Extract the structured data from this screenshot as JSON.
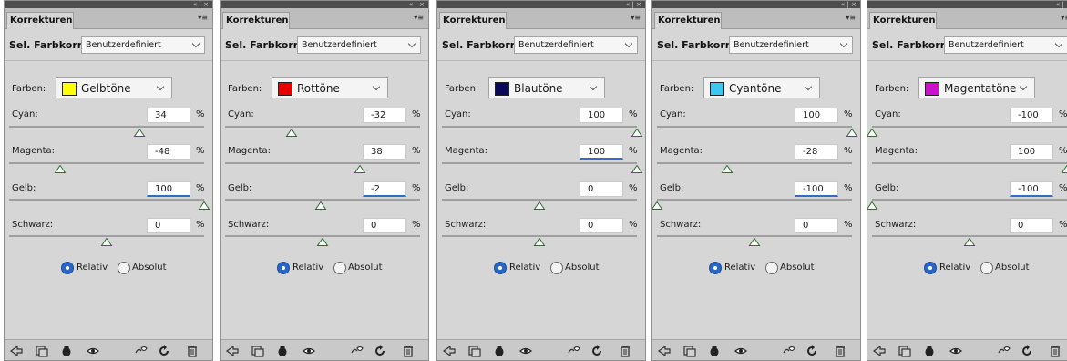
{
  "common": {
    "panel_tab": "Korrekturen",
    "adjustment_label": "Sel. Farbkorr.",
    "preset_value": "Benutzerdefiniert",
    "farben_label": "Farben:",
    "pct": "%",
    "relativ_label": "Relativ",
    "absolut_label": "Absolut",
    "method_selected": "Relativ",
    "titlebar_controls": "« | ×",
    "footer_icons": [
      "clip-to-layer-icon",
      "view-previous-state-icon",
      "reset-icon",
      "toggle-visibility-icon",
      "delete-icon"
    ]
  },
  "panels": [
    {
      "color_name": "Gelbtöne",
      "swatch": "#ffff00",
      "channels": [
        {
          "label": "Cyan:",
          "value": "34",
          "focused": false
        },
        {
          "label": "Magenta:",
          "value": "-48",
          "focused": false
        },
        {
          "label": "Gelb:",
          "value": "100",
          "focused": true
        },
        {
          "label": "Schwarz:",
          "value": "0",
          "focused": false
        }
      ]
    },
    {
      "color_name": "Rottöne",
      "swatch": "#e60000",
      "channels": [
        {
          "label": "Cyan:",
          "value": "-32",
          "focused": false
        },
        {
          "label": "Magenta:",
          "value": "38",
          "focused": false
        },
        {
          "label": "Gelb:",
          "value": "-2",
          "focused": true
        },
        {
          "label": "Schwarz:",
          "value": "0",
          "focused": false
        }
      ]
    },
    {
      "color_name": "Blautöne",
      "swatch": "#0a0a5a",
      "channels": [
        {
          "label": "Cyan:",
          "value": "100",
          "focused": false
        },
        {
          "label": "Magenta:",
          "value": "100",
          "focused": true
        },
        {
          "label": "Gelb:",
          "value": "0",
          "focused": false
        },
        {
          "label": "Schwarz:",
          "value": "0",
          "focused": false
        }
      ]
    },
    {
      "color_name": "Cyantöne",
      "swatch": "#3fc6f0",
      "channels": [
        {
          "label": "Cyan:",
          "value": "100",
          "focused": false
        },
        {
          "label": "Magenta:",
          "value": "-28",
          "focused": false
        },
        {
          "label": "Gelb:",
          "value": "-100",
          "focused": true
        },
        {
          "label": "Schwarz:",
          "value": "0",
          "focused": false
        }
      ]
    },
    {
      "color_name": "Magentatöne",
      "swatch": "#cc11cc",
      "channels": [
        {
          "label": "Cyan:",
          "value": "-100",
          "focused": false
        },
        {
          "label": "Magenta:",
          "value": "100",
          "focused": false
        },
        {
          "label": "Gelb:",
          "value": "-100",
          "focused": true
        },
        {
          "label": "Schwarz:",
          "value": "0",
          "focused": false
        }
      ]
    }
  ]
}
